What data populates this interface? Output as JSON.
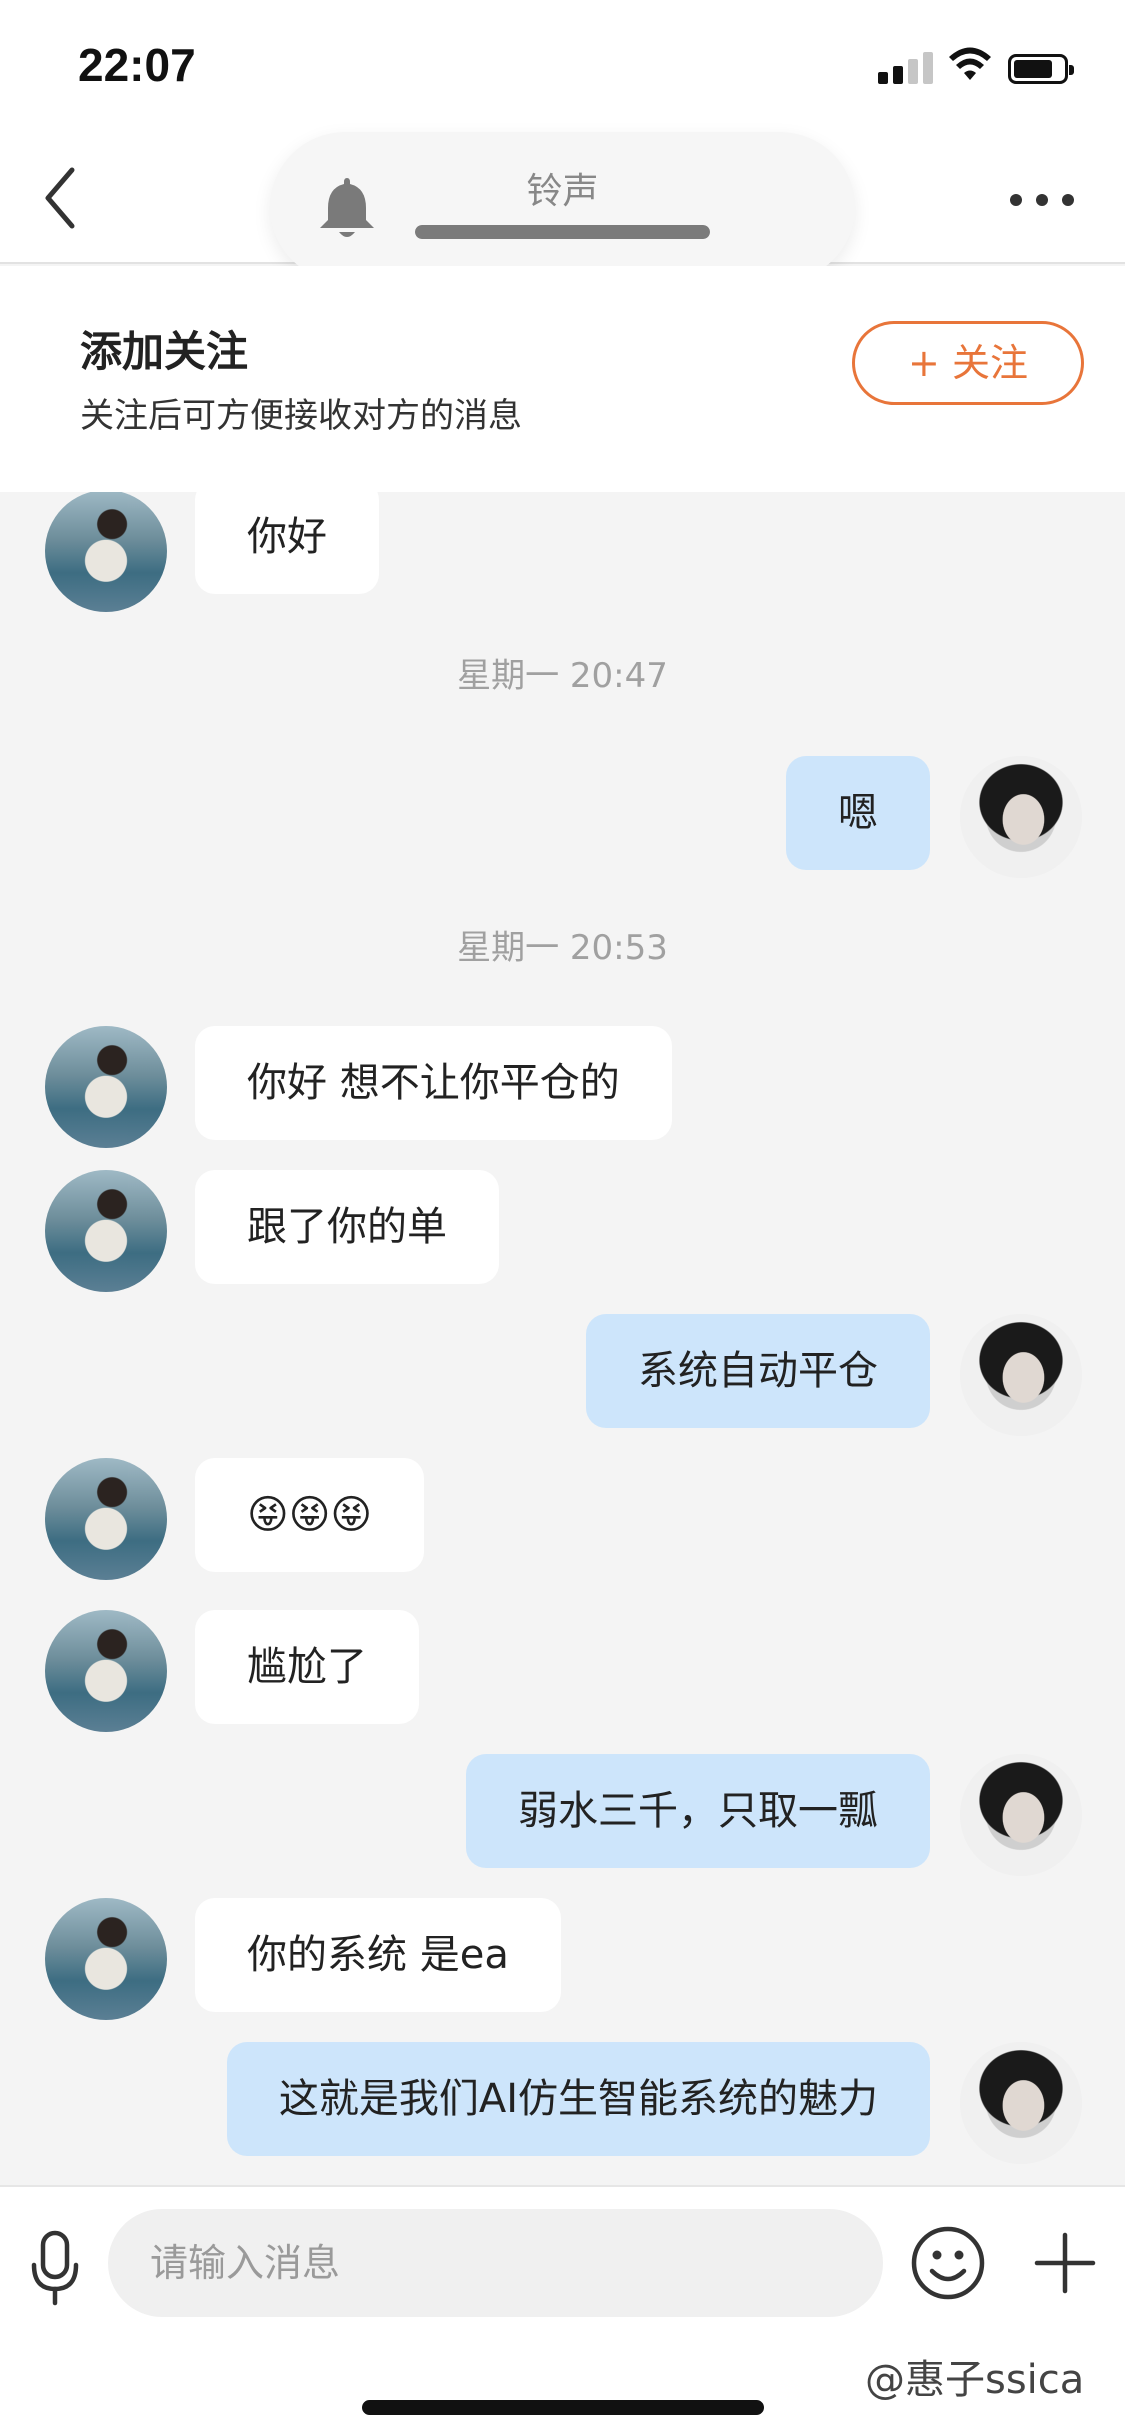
{
  "status_bar": {
    "time": "22:07"
  },
  "header": {
    "back_icon": "chevron-left-icon",
    "more_icon": "more-dots-icon",
    "ringtone": {
      "label": "铃声",
      "icon": "bell-icon",
      "volume_level": 1.0
    }
  },
  "follow_banner": {
    "title": "添加关注",
    "subtitle": "关注后可方便接收对方的消息",
    "button_label": "+ 关注",
    "accent_color": "#e8753a"
  },
  "messages": [
    {
      "side": "left",
      "text": "你好"
    },
    {
      "timestamp": "星期一 20:47"
    },
    {
      "side": "right",
      "text": "嗯"
    },
    {
      "timestamp": "星期一 20:53"
    },
    {
      "side": "left",
      "text": "你好 想不让你平仓的"
    },
    {
      "side": "left",
      "text": "跟了你的单"
    },
    {
      "side": "right",
      "text": "系统自动平仓"
    },
    {
      "side": "left",
      "text": "😝😝😝"
    },
    {
      "side": "left",
      "text": "尴尬了"
    },
    {
      "side": "right",
      "text": "弱水三千，只取一瓢"
    },
    {
      "side": "left",
      "text": "你的系统  是ea"
    },
    {
      "side": "right",
      "text": "这就是我们AI仿生智能系统的魅力"
    }
  ],
  "input_bar": {
    "placeholder": "请输入消息",
    "mic_icon": "microphone-icon",
    "emoji_icon": "smiley-icon",
    "plus_icon": "plus-icon"
  },
  "watermark": "@惠子ssica",
  "colors": {
    "outgoing_bubble": "#cde5fb",
    "incoming_bubble": "#ffffff",
    "chat_background": "#f4f4f4"
  }
}
